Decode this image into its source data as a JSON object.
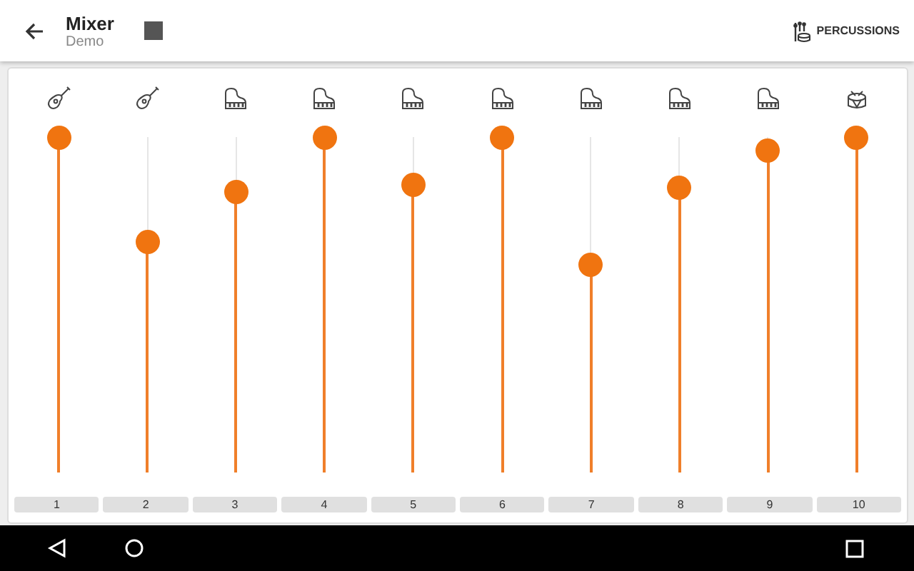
{
  "header": {
    "title": "Mixer",
    "subtitle": "Demo",
    "action": "PERCUSSIONS"
  },
  "channels": [
    {
      "kind": "guitar",
      "label": "1",
      "level": 1.0
    },
    {
      "kind": "guitar",
      "label": "2",
      "level": 0.69
    },
    {
      "kind": "piano",
      "label": "3",
      "level": 0.84
    },
    {
      "kind": "piano",
      "label": "4",
      "level": 1.0
    },
    {
      "kind": "piano",
      "label": "5",
      "level": 0.86
    },
    {
      "kind": "piano",
      "label": "6",
      "level": 1.0
    },
    {
      "kind": "piano",
      "label": "7",
      "level": 0.62
    },
    {
      "kind": "piano",
      "label": "8",
      "level": 0.85
    },
    {
      "kind": "piano",
      "label": "9",
      "level": 0.96
    },
    {
      "kind": "drum",
      "label": "10",
      "level": 1.0
    }
  ]
}
